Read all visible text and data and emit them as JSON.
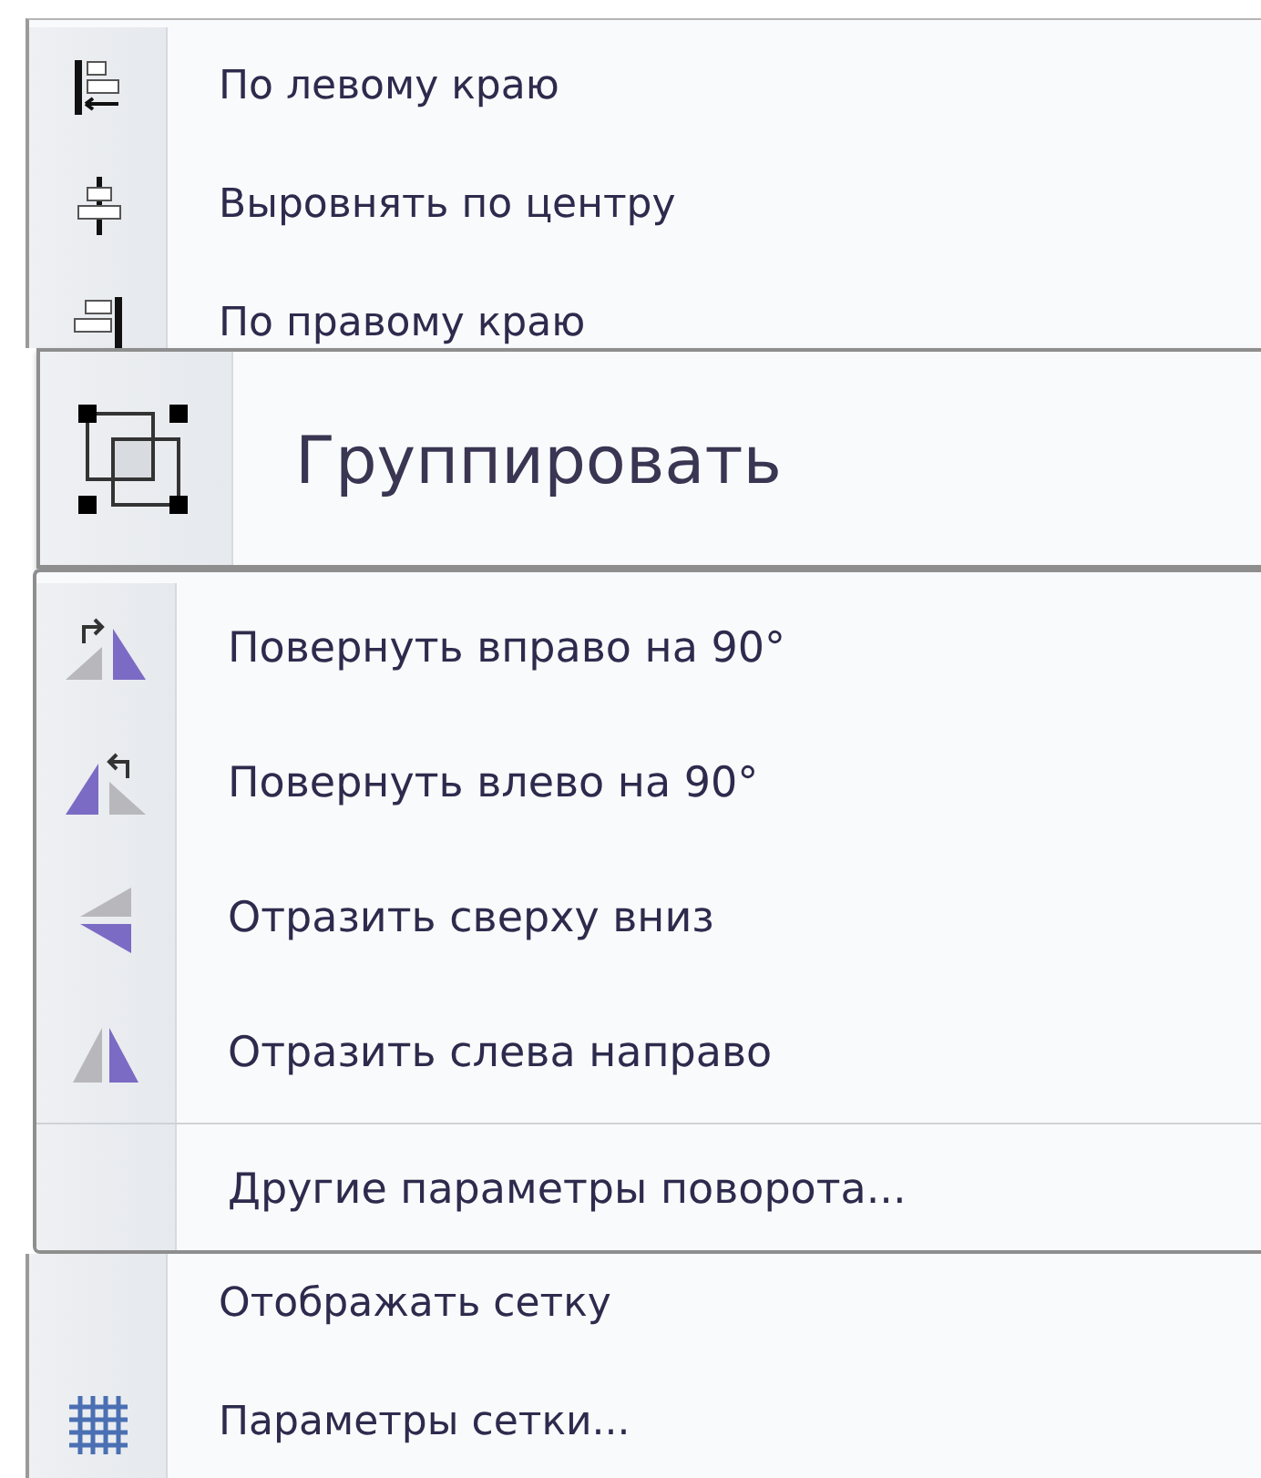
{
  "align_menu": {
    "items": [
      {
        "kind": "align-left",
        "label": "По левому краю"
      },
      {
        "kind": "align-center",
        "label": "Выровнять по центру"
      },
      {
        "kind": "align-right",
        "label": "По правому краю"
      }
    ]
  },
  "group_menu": {
    "items": [
      {
        "kind": "group",
        "label": "Группировать"
      }
    ]
  },
  "rotate_menu": {
    "items": [
      {
        "kind": "rotate-right",
        "label": "Повернуть вправо на 90°"
      },
      {
        "kind": "rotate-left",
        "label": "Повернуть влево на 90°"
      },
      {
        "kind": "flip-vertical",
        "label": "Отразить сверху вниз"
      },
      {
        "kind": "flip-horizontal",
        "label": "Отразить слева направо"
      },
      {
        "kind": "more",
        "label": "Другие параметры поворота..."
      }
    ]
  },
  "grid_menu": {
    "items": [
      {
        "kind": "toggle",
        "label": "Отображать сетку"
      },
      {
        "kind": "grid",
        "label": "Параметры сетки..."
      }
    ]
  }
}
